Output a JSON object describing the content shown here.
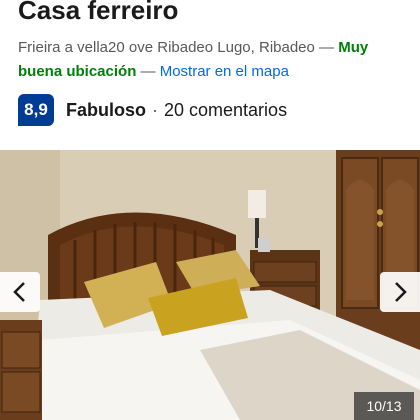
{
  "property": {
    "name": "Casa ferreiro",
    "address": "Frieira a vella20 ove Ribadeo Lugo, Ribadeo",
    "separator": " — ",
    "location_tag": "Muy buena ubicación",
    "map_link": "Mostrar en el mapa"
  },
  "rating": {
    "score": "8,9",
    "word": "Fabuloso",
    "dot": "·",
    "reviews": "20 comentarios",
    "score_color": "#003b95"
  },
  "gallery": {
    "counter": "10/13",
    "prev_icon": "chevron-left-icon",
    "next_icon": "chevron-right-icon"
  },
  "colors": {
    "location_green": "#008009",
    "link_blue": "#006ce4"
  }
}
